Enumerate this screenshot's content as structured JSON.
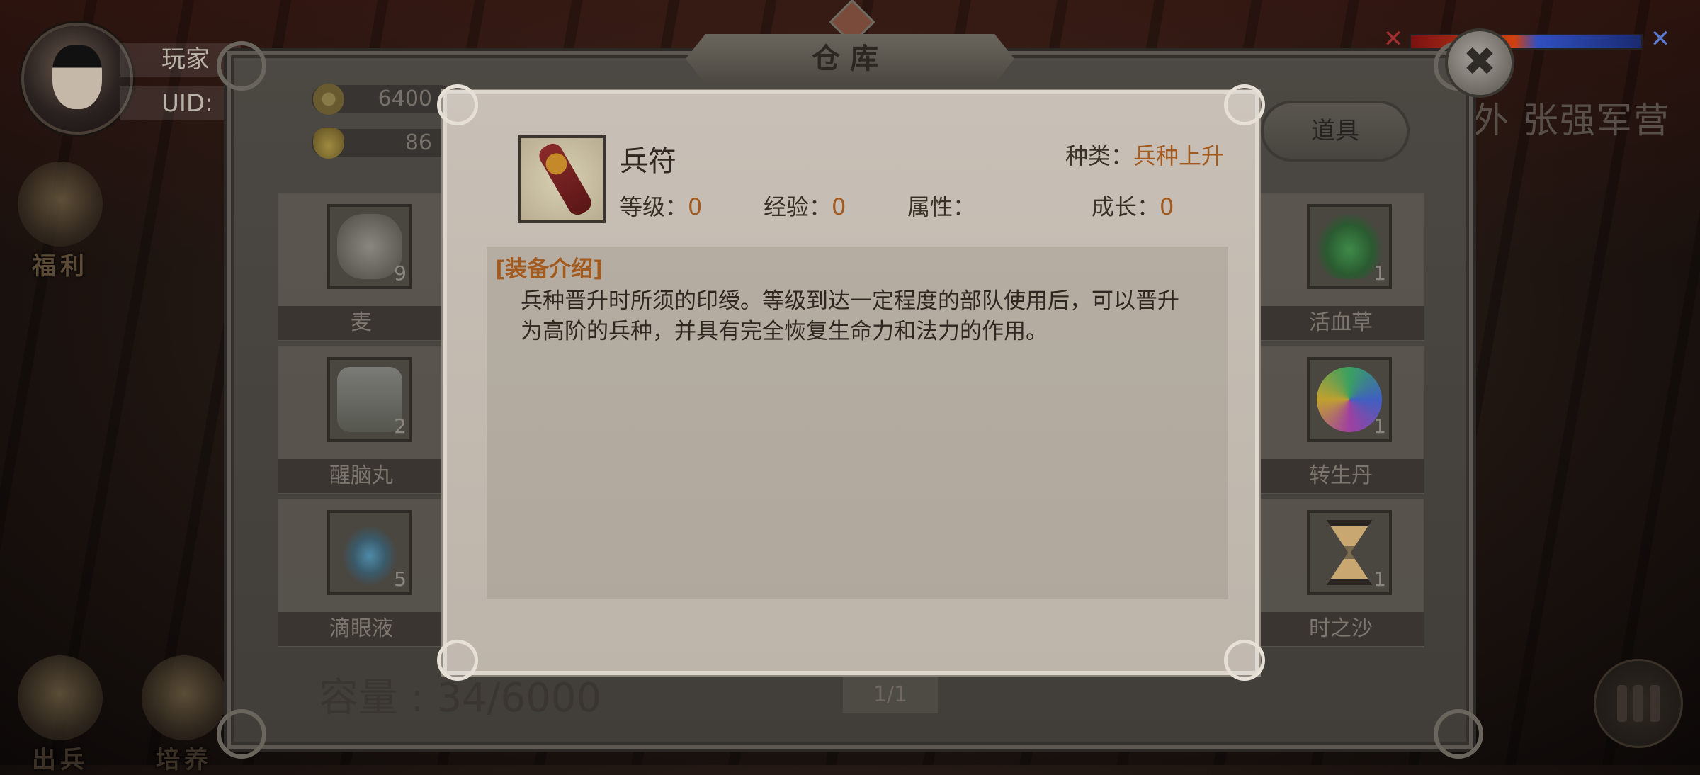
{
  "player": {
    "name_label": "玩家",
    "uid_label": "UID:"
  },
  "side_buttons": {
    "welfare": "福利",
    "dispatch": "出兵",
    "train": "培养"
  },
  "location": "外  张强军营",
  "warehouse": {
    "title": "仓库",
    "close_icon": "close-icon",
    "currency": {
      "coins": "6400",
      "ingots": "86"
    },
    "tab_label": "道具",
    "items_left": [
      {
        "name": "麦",
        "count": "9",
        "art_color": "#6a6760"
      },
      {
        "name": "醒脑丸",
        "count": "2",
        "art_color": "#5d5f5a"
      },
      {
        "name": "滴眼液",
        "count": "5",
        "art_color": "#3f6f8a"
      }
    ],
    "items_right": [
      {
        "name": "活血草",
        "count": "1",
        "art_color": "#2f6a3a"
      },
      {
        "name": "转生丹",
        "count": "1",
        "art_color": "#3f8a5a"
      },
      {
        "name": "时之沙",
        "count": "1",
        "art_color": "#8a6a40"
      }
    ],
    "capacity_label": "容量 : ",
    "capacity_value": "34/6000",
    "page": "1/1"
  },
  "detail": {
    "item_name": "兵符",
    "kind_label": "种类：",
    "kind_value": "兵种上升",
    "stats": {
      "level_label": "等级：",
      "level_value": "0",
      "exp_label": "经验：",
      "exp_value": "0",
      "attr_label": "属性：",
      "growth_label": "成长：",
      "growth_value": "0"
    },
    "desc_heading": "[装备介绍]",
    "desc_text": "兵种晋升时所须的印绶。等级到达一定程度的部队使用后，可以晋升为高阶的兵种，并具有完全恢复生命力和法力的作用。"
  },
  "colors": {
    "accent": "#a35a1e",
    "popup_bg": "#c4bcb1"
  }
}
